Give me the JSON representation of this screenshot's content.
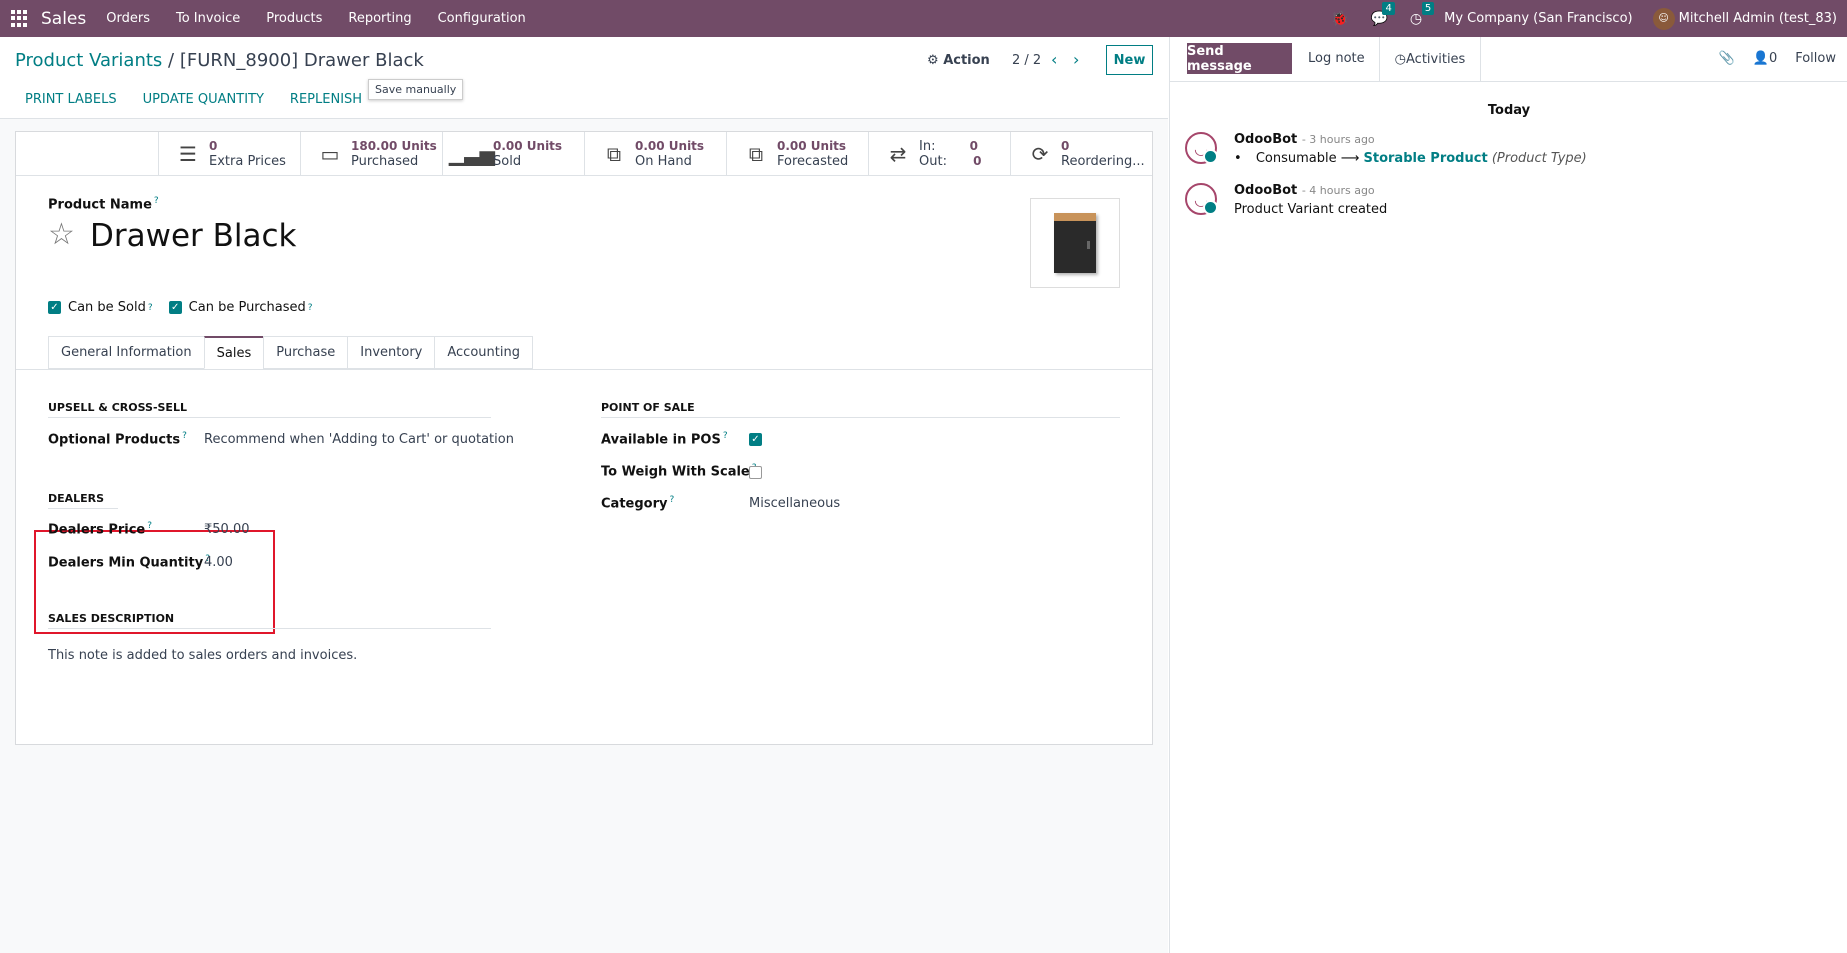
{
  "nav": {
    "app_name": "Sales",
    "menus": [
      "Orders",
      "To Invoice",
      "Products",
      "Reporting",
      "Configuration"
    ],
    "messages_count": "4",
    "activities_count": "5",
    "company": "My Company (San Francisco)",
    "user": "Mitchell Admin (test_83)"
  },
  "control": {
    "breadcrumb_parent": "Product Variants",
    "breadcrumb_sep": "/",
    "breadcrumb_current": "[FURN_8900] Drawer Black",
    "save_tooltip": "Save manually",
    "action_label": "Action",
    "pager": "2 / 2",
    "new_label": "New",
    "buttons": [
      "PRINT LABELS",
      "UPDATE QUANTITY",
      "REPLENISH"
    ]
  },
  "stats": {
    "extra_prices_value": "0",
    "extra_prices_label": "Extra Prices",
    "purchased_value": "180.00 Units",
    "purchased_label": "Purchased",
    "sold_value": "0.00 Units",
    "sold_label": "Sold",
    "onhand_value": "0.00 Units",
    "onhand_label": "On Hand",
    "forecasted_value": "0.00 Units",
    "forecasted_label": "Forecasted",
    "in_label": "In:",
    "in_value": "0",
    "out_label": "Out:",
    "out_value": "0",
    "reorder_value": "0",
    "reorder_label": "Reordering..."
  },
  "product": {
    "name_label": "Product Name",
    "name": "Drawer Black",
    "can_be_sold": "Can be Sold",
    "can_be_purchased": "Can be Purchased"
  },
  "tabs": [
    "General Information",
    "Sales",
    "Purchase",
    "Inventory",
    "Accounting"
  ],
  "sales_tab": {
    "upsell_title": "UPSELL & CROSS-SELL",
    "optional_products_label": "Optional Products",
    "optional_products_placeholder": "Recommend when 'Adding to Cart' or quotation",
    "dealers_title": "DEALERS",
    "dealers_price_label": "Dealers Price",
    "dealers_price_value": "₹50.00",
    "dealers_min_qty_label": "Dealers Min Quantity",
    "dealers_min_qty_value": "4.00",
    "sales_desc_title": "SALES DESCRIPTION",
    "sales_desc_text": "This note is added to sales orders and invoices.",
    "pos_title": "POINT OF SALE",
    "available_in_pos_label": "Available in POS",
    "weigh_label": "To Weigh With Scale",
    "category_label": "Category",
    "category_value": "Miscellaneous"
  },
  "chatter": {
    "send_message": "Send message",
    "log_note": "Log note",
    "activities": "Activities",
    "followers_count": "0",
    "follow": "Follow",
    "today": "Today",
    "messages": [
      {
        "author": "OdooBot",
        "time": "- 3 hours ago",
        "old": "Consumable",
        "new": "Storable Product",
        "field": "(Product Type)"
      },
      {
        "author": "OdooBot",
        "time": "- 4 hours ago",
        "body": "Product Variant created"
      }
    ]
  }
}
